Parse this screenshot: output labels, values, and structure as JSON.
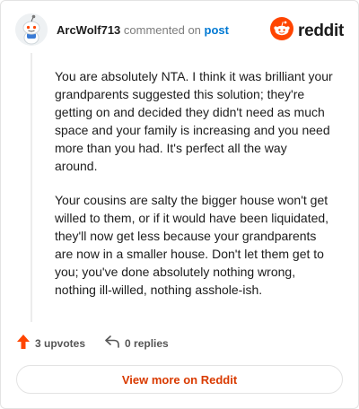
{
  "header": {
    "username": "ArcWolf713",
    "commented_on": "commented on",
    "post_link": "post",
    "brand_word": "reddit",
    "avatar_icon": "snoo-avatar-icon",
    "logo_icon": "reddit-logo-icon"
  },
  "comment": {
    "paragraphs": [
      "You are absolutely NTA. I think it was brilliant your grandparents suggested this solution; they're getting on and decided they didn't need as much space and your family is increasing and you need more than you had. It's perfect all the way around.",
      "Your cousins are salty the bigger house won't get willed to them, or if it would have been liquidated, they'll now get less because your grandparents are now in a smaller house. Don't let them get to you; you've done absolutely nothing wrong, nothing ill-willed, nothing asshole-ish."
    ]
  },
  "actions": {
    "upvotes": "3 upvotes",
    "replies": "0 replies",
    "upvote_icon": "upvote-arrow-icon",
    "reply_icon": "reply-arrow-icon"
  },
  "footer": {
    "view_more": "View more on Reddit"
  },
  "colors": {
    "brand_orange": "#ff4500",
    "link_blue": "#0079d3",
    "button_text": "#d93a00"
  }
}
